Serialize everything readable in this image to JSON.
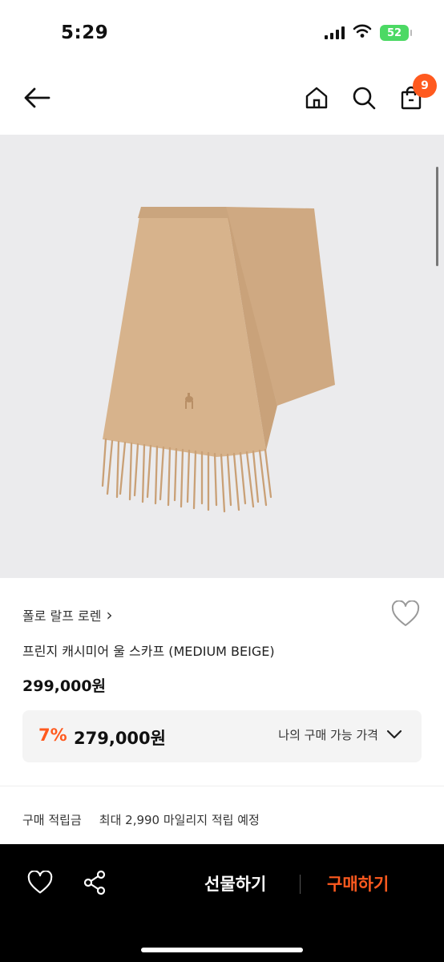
{
  "status": {
    "time": "5:29",
    "battery": "52"
  },
  "nav": {
    "cart_count": "9"
  },
  "product": {
    "brand": "폴로 랄프 로렌",
    "brand_chevron": "›",
    "name": "프린지 캐시미어 울 스카프 (MEDIUM BEIGE)",
    "price": "299,000원",
    "discount_rate": "7%",
    "discount_price": "279,000원",
    "my_price_label": "나의 구매 가능 가격",
    "points_label": "구매 적립금",
    "points_value": "최대 2,990 마일리지 적립 예정"
  },
  "bottom": {
    "gift_label": "선물하기",
    "buy_label": "구매하기"
  },
  "colors": {
    "accent": "#ff5a1f",
    "image_bg": "#ebebed",
    "scarf": "#d9b48e"
  },
  "icons": [
    "back-arrow-icon",
    "home-icon",
    "search-icon",
    "cart-icon",
    "heart-icon",
    "chevron-down-icon",
    "share-icon"
  ]
}
